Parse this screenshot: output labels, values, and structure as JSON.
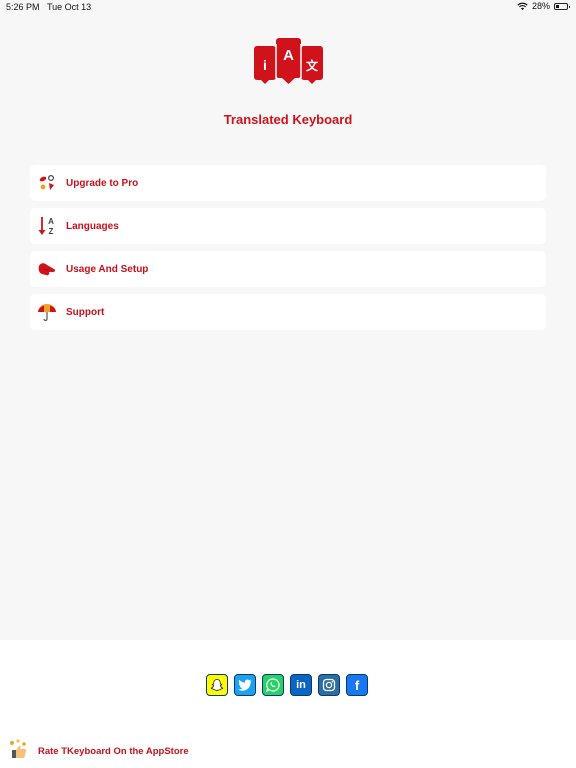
{
  "status_bar": {
    "time": "5:26 PM",
    "date": "Tue Oct 13",
    "battery_percent": "28%",
    "battery_level": 0.28,
    "icons": [
      "wifi-icon",
      "battery-icon"
    ]
  },
  "app": {
    "title": "Translated Keyboard",
    "logo_letters": {
      "left": "i",
      "center": "A",
      "right": "文"
    },
    "accent_color": "#d0121b"
  },
  "menu": {
    "items": [
      {
        "label": "Upgrade to Pro",
        "icon": "paint-palette-icon"
      },
      {
        "label": "Languages",
        "icon": "sort-az-icon"
      },
      {
        "label": "Usage And Setup",
        "icon": "pointing-hand-icon"
      },
      {
        "label": "Support",
        "icon": "umbrella-icon"
      }
    ]
  },
  "social": {
    "items": [
      {
        "name": "Snapchat",
        "icon": "snapchat-icon",
        "color": "#fffc00"
      },
      {
        "name": "Twitter",
        "icon": "twitter-icon",
        "color": "#1da1f2"
      },
      {
        "name": "WhatsApp",
        "icon": "whatsapp-icon",
        "color": "#25d366"
      },
      {
        "name": "LinkedIn",
        "icon": "linkedin-icon",
        "color": "#0a66c2",
        "glyph": "in"
      },
      {
        "name": "Instagram",
        "icon": "instagram-icon",
        "color": "#2b6ea3"
      },
      {
        "name": "Facebook",
        "icon": "facebook-icon",
        "color": "#1877f2",
        "glyph": "f"
      }
    ]
  },
  "footer": {
    "rate_label": "Rate TKeyboard On the AppStore",
    "rate_icon": "thumbs-up-icon"
  }
}
